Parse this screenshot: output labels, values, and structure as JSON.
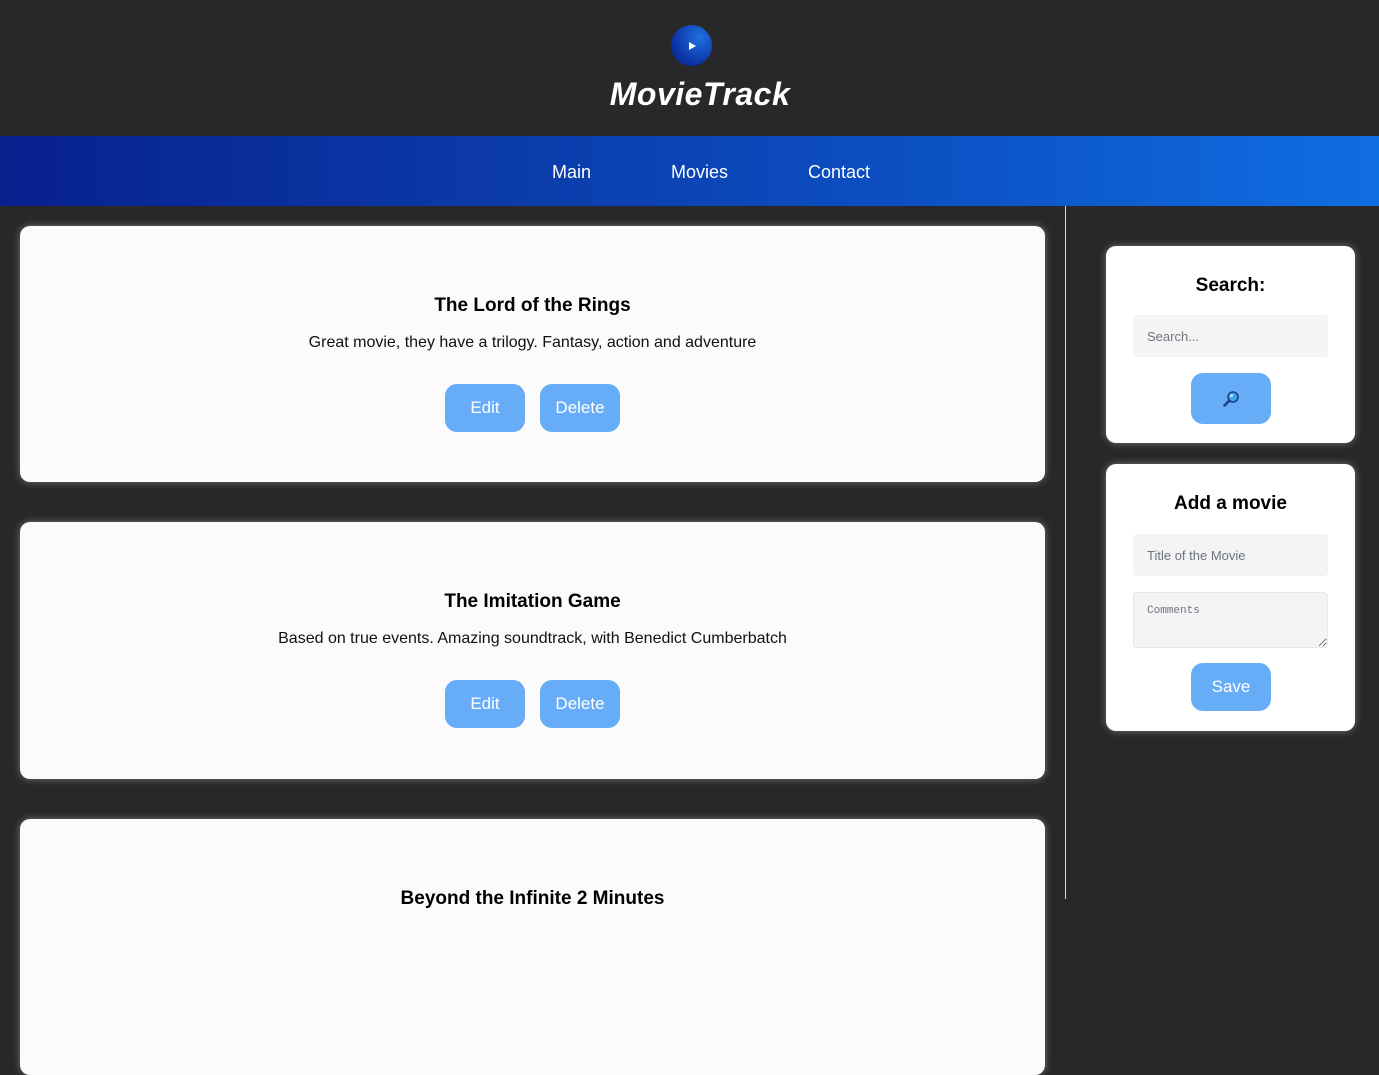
{
  "brand": {
    "name": "MovieTrack",
    "logo_icon": "play-icon"
  },
  "nav": {
    "items": [
      {
        "label": "Main"
      },
      {
        "label": "Movies"
      },
      {
        "label": "Contact"
      }
    ]
  },
  "movies": [
    {
      "title": "The Lord of the Rings",
      "comment": "Great movie, they have a trilogy. Fantasy, action and adventure",
      "edit_label": "Edit",
      "delete_label": "Delete"
    },
    {
      "title": "The Imitation Game",
      "comment": "Based on true events. Amazing soundtrack, with Benedict Cumberbatch",
      "edit_label": "Edit",
      "delete_label": "Delete"
    },
    {
      "title": "Beyond the Infinite 2 Minutes"
    }
  ],
  "sidebar": {
    "search": {
      "title": "Search:",
      "placeholder": "Search...",
      "button_icon": "magnifier-icon"
    },
    "add_movie": {
      "title": "Add a movie",
      "title_placeholder": "Title of the Movie",
      "comments_placeholder": "Comments",
      "save_label": "Save"
    }
  },
  "colors": {
    "background": "#28282b",
    "nav_gradient_start": "#07208e",
    "nav_gradient_end": "#0f6ee2",
    "button": "#67acf7",
    "card": "#fcfbfc"
  }
}
